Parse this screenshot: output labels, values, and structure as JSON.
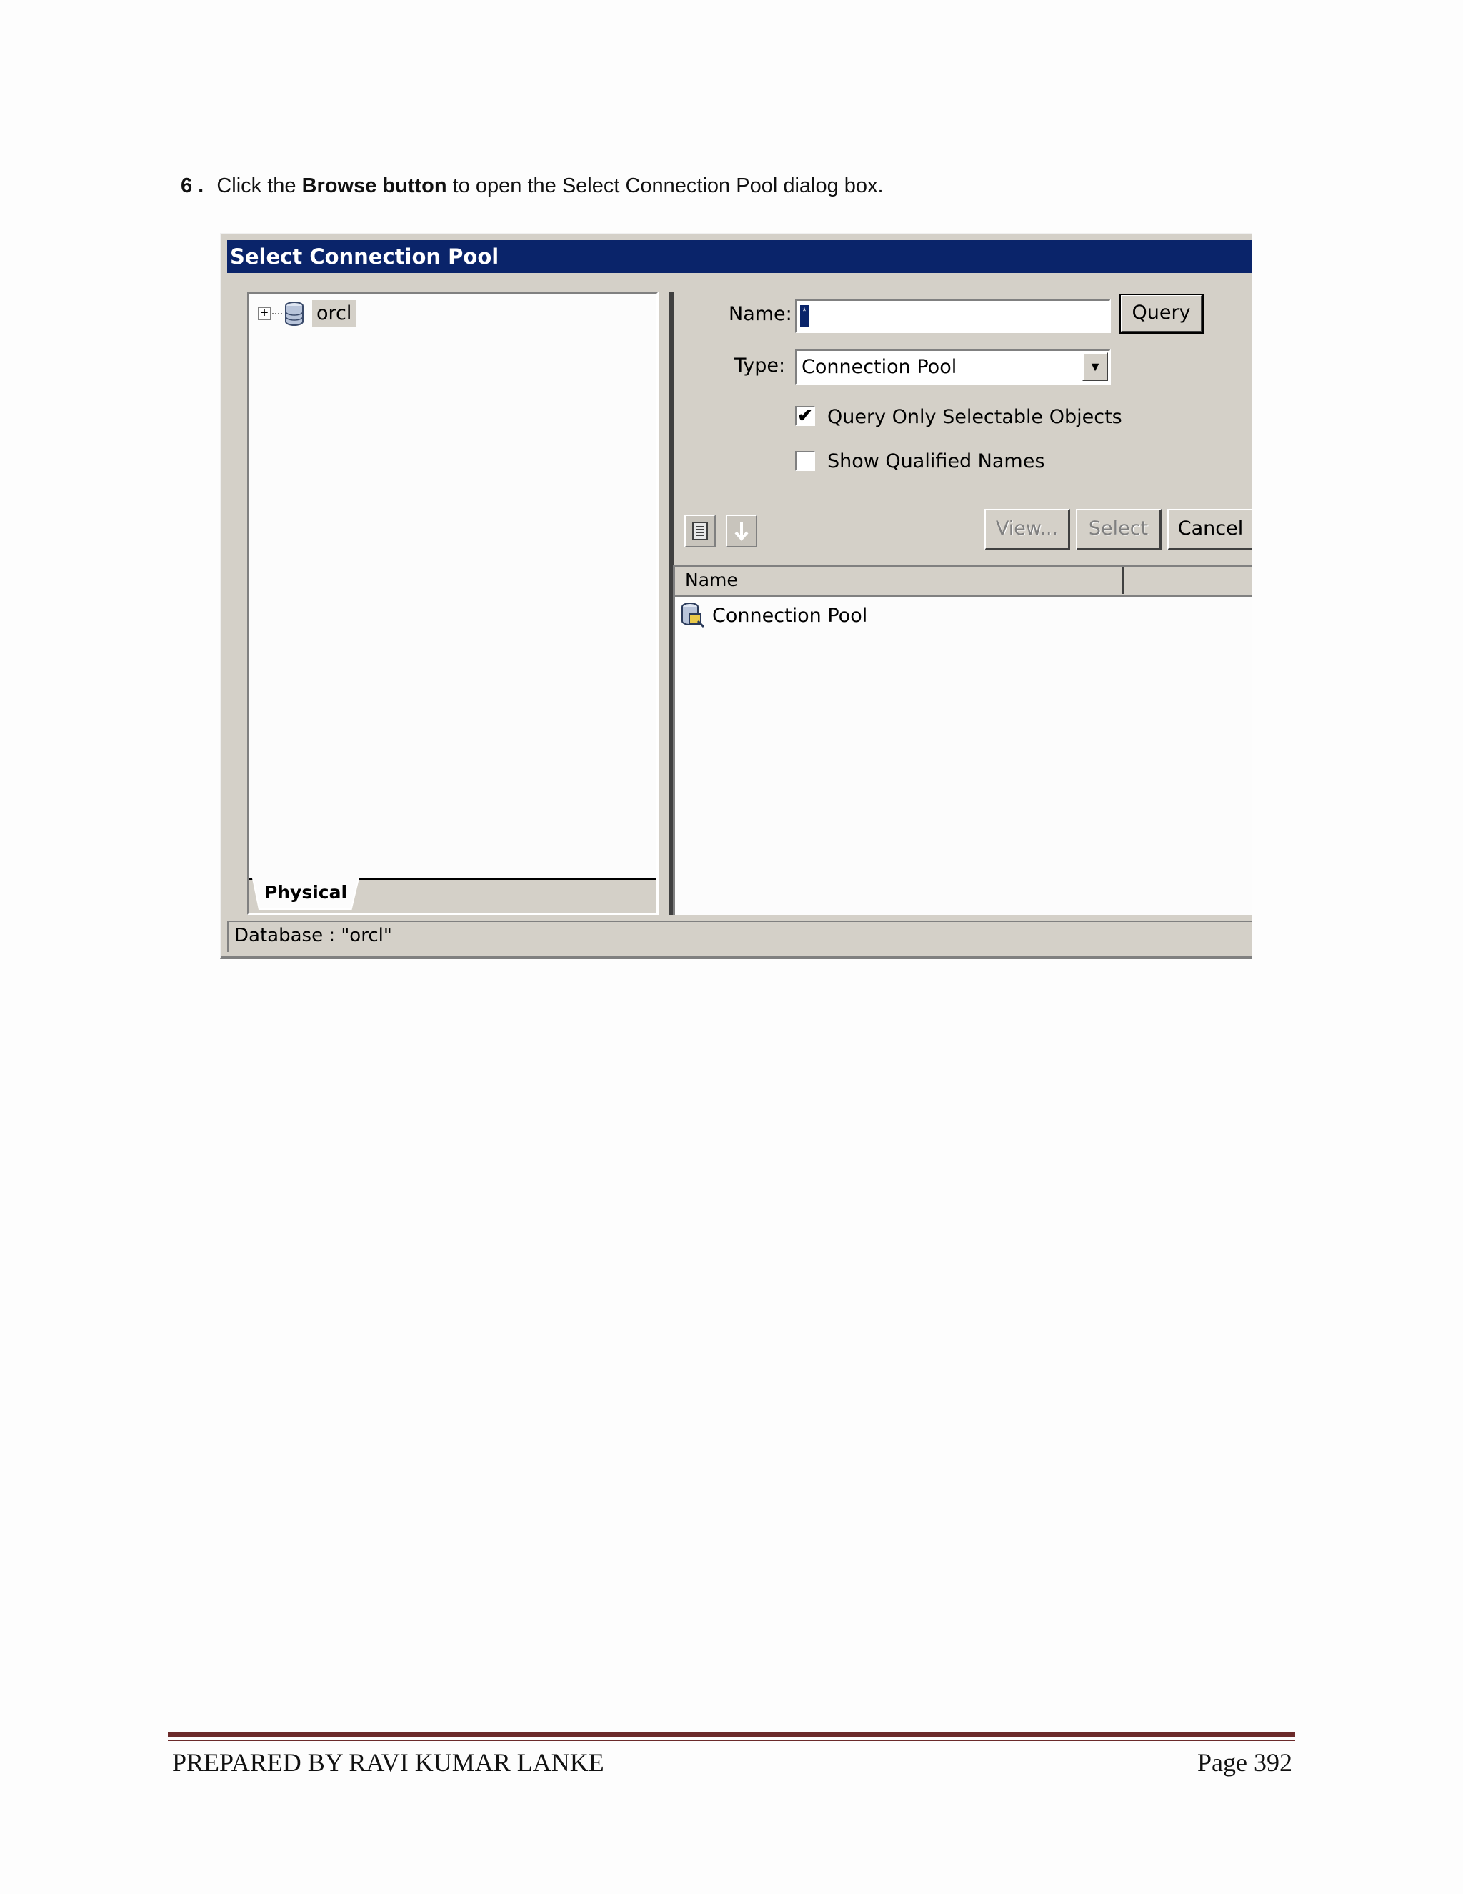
{
  "step": {
    "number": "6 .",
    "text_before": "Click the ",
    "bold": "Browse button",
    "text_after": " to open the Select Connection Pool dialog box."
  },
  "dialog": {
    "title": "Select Connection Pool",
    "tree": {
      "expander": "+",
      "node_label": "orcl",
      "node_icon": "database-icon",
      "tab_label": "Physical"
    },
    "name_label": "Name:",
    "name_value": "*",
    "query_button": "Query",
    "type_label": "Type:",
    "type_value": "Connection Pool",
    "checkbox_selectable": {
      "label": "Query Only Selectable Objects",
      "checked": true
    },
    "checkbox_qualified": {
      "label": "Show Qualified Names",
      "checked": false
    },
    "view_button": "View...",
    "select_button": "Select",
    "cancel_button": "Cancel",
    "list": {
      "column_header": "Name",
      "rows": [
        {
          "label": "Connection Pool",
          "icon": "connection-pool-icon"
        }
      ]
    },
    "status_text": "Database : \"orcl\""
  },
  "footer": {
    "left": "PREPARED BY RAVI KUMAR LANKE",
    "right": "Page 392"
  }
}
